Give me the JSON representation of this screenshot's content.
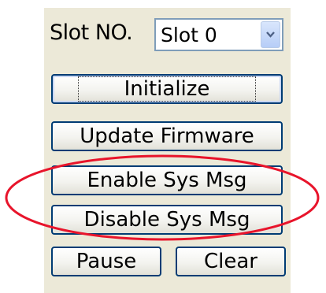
{
  "slot": {
    "label": "Slot NO.",
    "selected": "Slot 0"
  },
  "buttons": {
    "initialize": "Initialize",
    "update_firmware": "Update Firmware",
    "enable_sys_msg": "Enable Sys Msg",
    "disable_sys_msg": "Disable Sys Msg",
    "pause": "Pause",
    "clear": "Clear"
  },
  "colors": {
    "panel_background": "#ece9d8",
    "button_border": "#003c74",
    "highlight_oval": "#e8142b"
  },
  "icons": {
    "dropdown_arrow": "chevron-down-icon"
  }
}
